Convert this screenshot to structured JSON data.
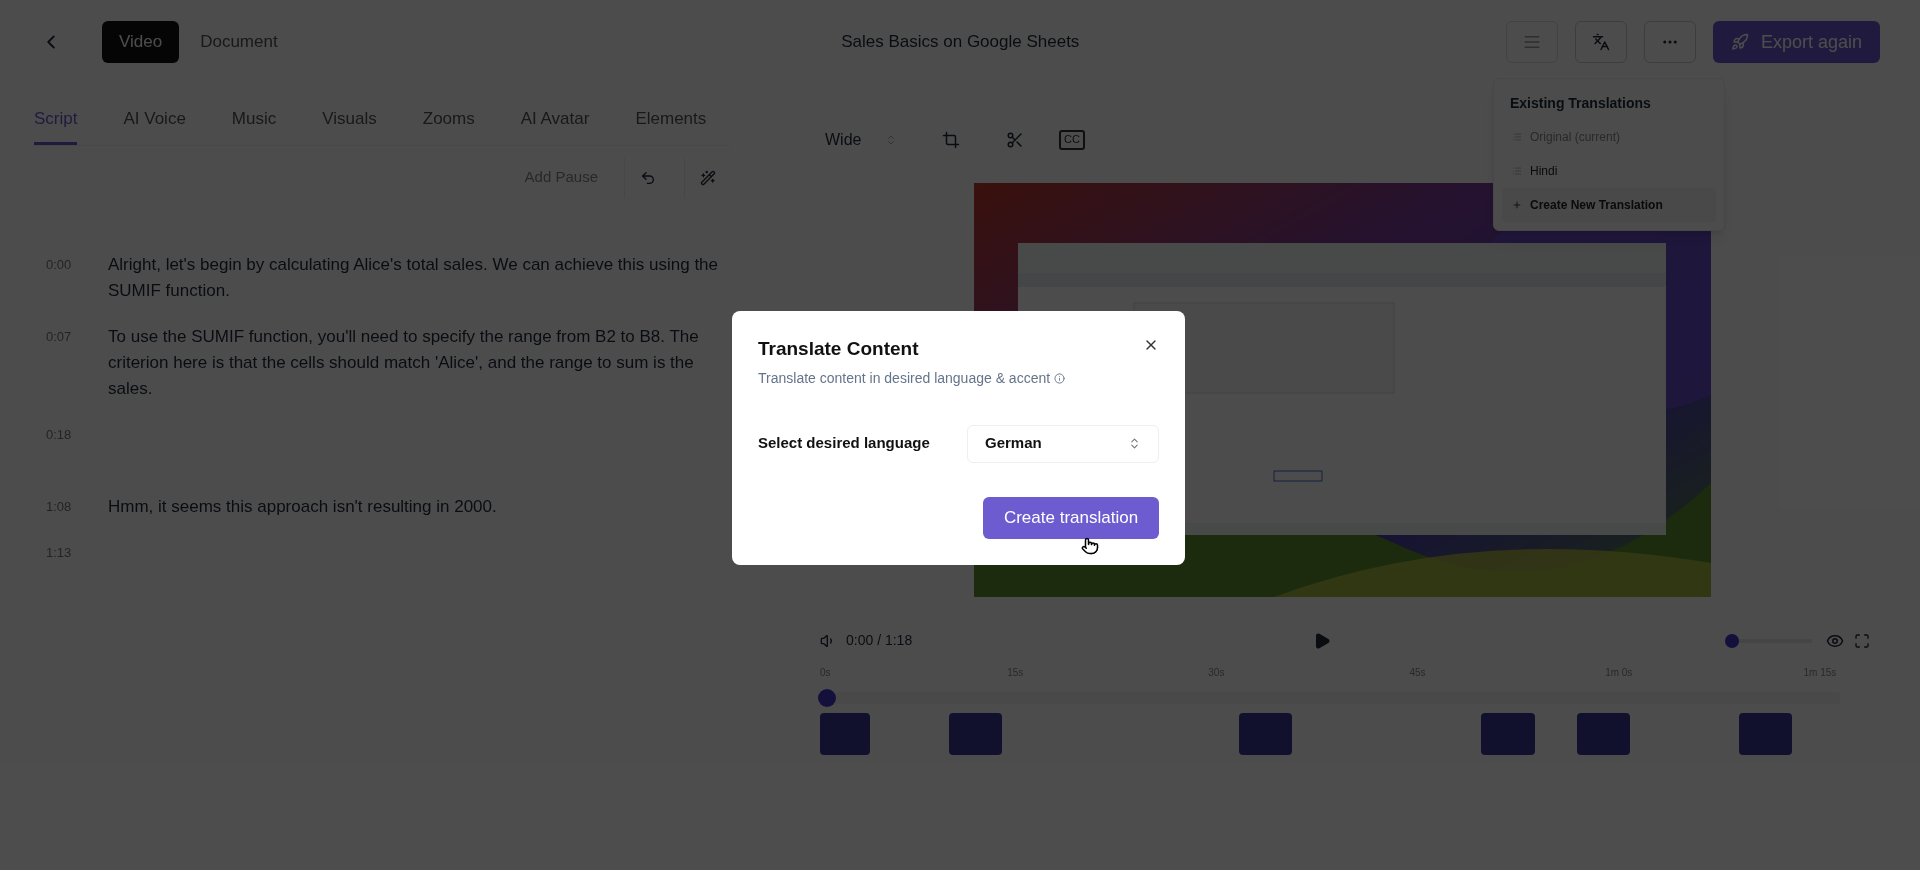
{
  "header": {
    "tabs": [
      {
        "label": "Video",
        "selected": true
      },
      {
        "label": "Document",
        "selected": false
      }
    ],
    "title": "Sales Basics on Google Sheets",
    "export_button": "Export again"
  },
  "editor_tabs": [
    {
      "label": "Script",
      "selected": true
    },
    {
      "label": "AI Voice",
      "selected": false
    },
    {
      "label": "Music",
      "selected": false
    },
    {
      "label": "Visuals",
      "selected": false
    },
    {
      "label": "Zooms",
      "selected": false
    },
    {
      "label": "AI Avatar",
      "selected": false
    },
    {
      "label": "Elements",
      "selected": false
    }
  ],
  "script_toolbar": {
    "add_pause": "Add Pause"
  },
  "script": [
    {
      "time": "0:00",
      "text": "Alright, let's begin by calculating Alice's total sales. We can achieve this using the SUMIF function."
    },
    {
      "time": "0:07",
      "text": "To use the SUMIF function, you'll need to specify the range from B2 to B8. The criterion here is that the cells should match 'Alice', and the range to sum is the sales."
    },
    {
      "time": "0:18"
    },
    {
      "time": "1:08",
      "text": "Hmm, it seems this approach isn't resulting in 2000."
    },
    {
      "time": "1:13"
    }
  ],
  "preview": {
    "aspect": "Wide",
    "captions": "CC"
  },
  "translations_menu": {
    "title": "Existing Translations",
    "items": [
      {
        "label": "Original (current)",
        "kind": "version",
        "disabled": true
      },
      {
        "label": "Hindi",
        "kind": "version",
        "disabled": false
      },
      {
        "label": "Create New Translation",
        "kind": "create",
        "disabled": false
      }
    ]
  },
  "player": {
    "time": "0:00 / 1:18",
    "volume": {
      "level": 0
    }
  },
  "timeline": {
    "ticks": [
      "0s",
      "15s",
      "30s",
      "45s",
      "1m 0s",
      "1m 15s"
    ],
    "playhead": {
      "level": 0
    }
  },
  "modal": {
    "title": "Translate Content",
    "subtitle": "Translate content in desired language & accent",
    "field_label": "Select desired language",
    "language": "German",
    "button": "Create translation"
  }
}
